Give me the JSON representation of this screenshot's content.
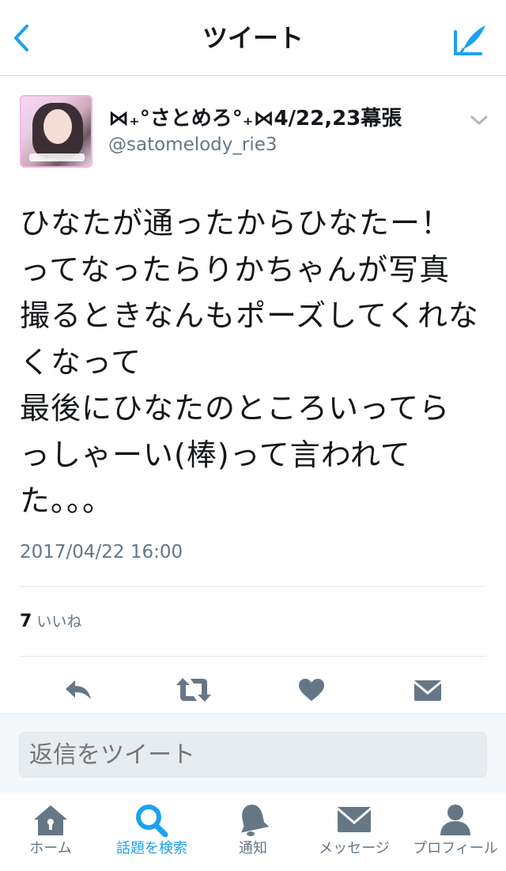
{
  "header": {
    "title": "ツイート"
  },
  "tweet": {
    "display_name": "⋈₊°さとめろ°₊⋈4/22,23幕張",
    "handle": "@satomelody_rie3",
    "text_lines": [
      "ひなたが通ったからひなたー！",
      "ってなったらりかちゃんが写真",
      "撮るときなんもポーズしてくれな",
      "くなって",
      "最後にひなたのところいってら",
      "っしゃーい(棒)って言われて",
      "た。。。"
    ],
    "timestamp": "2017/04/22 16:00",
    "likes_count": "7",
    "likes_label": "いいね"
  },
  "reply": {
    "placeholder": "返信をツイート"
  },
  "tabs": [
    {
      "label": "ホーム",
      "icon": "home-icon",
      "active": false
    },
    {
      "label": "話題を検索",
      "icon": "search-icon",
      "active": true
    },
    {
      "label": "通知",
      "icon": "bell-icon",
      "active": false
    },
    {
      "label": "メッセージ",
      "icon": "envelope-icon",
      "active": false
    },
    {
      "label": "プロフィール",
      "icon": "person-icon",
      "active": false
    }
  ],
  "colors": {
    "accent": "#1da1f2",
    "icon_gray": "#657786",
    "text": "#14171a"
  }
}
